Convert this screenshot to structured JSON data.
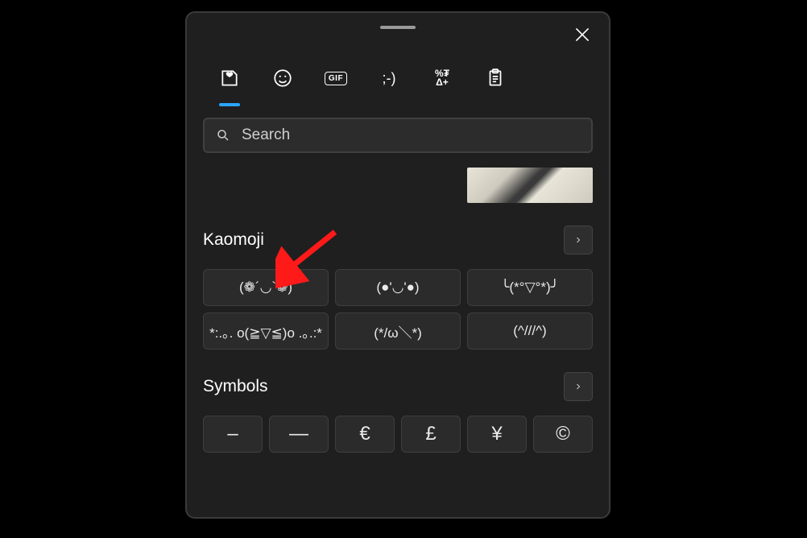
{
  "search": {
    "placeholder": "Search"
  },
  "sections": {
    "kaomoji": {
      "title": "Kaomoji",
      "items": [
        "(❁´◡`❁)",
        "(●'◡'●)",
        "╰(*°▽°*)╯",
        "*:.｡. o(≧▽≦)o .｡.:*",
        "(*/ω＼*)",
        "(^///^)"
      ]
    },
    "symbols": {
      "title": "Symbols",
      "items": [
        "–",
        "—",
        "€",
        "£",
        "¥",
        "©"
      ]
    }
  }
}
